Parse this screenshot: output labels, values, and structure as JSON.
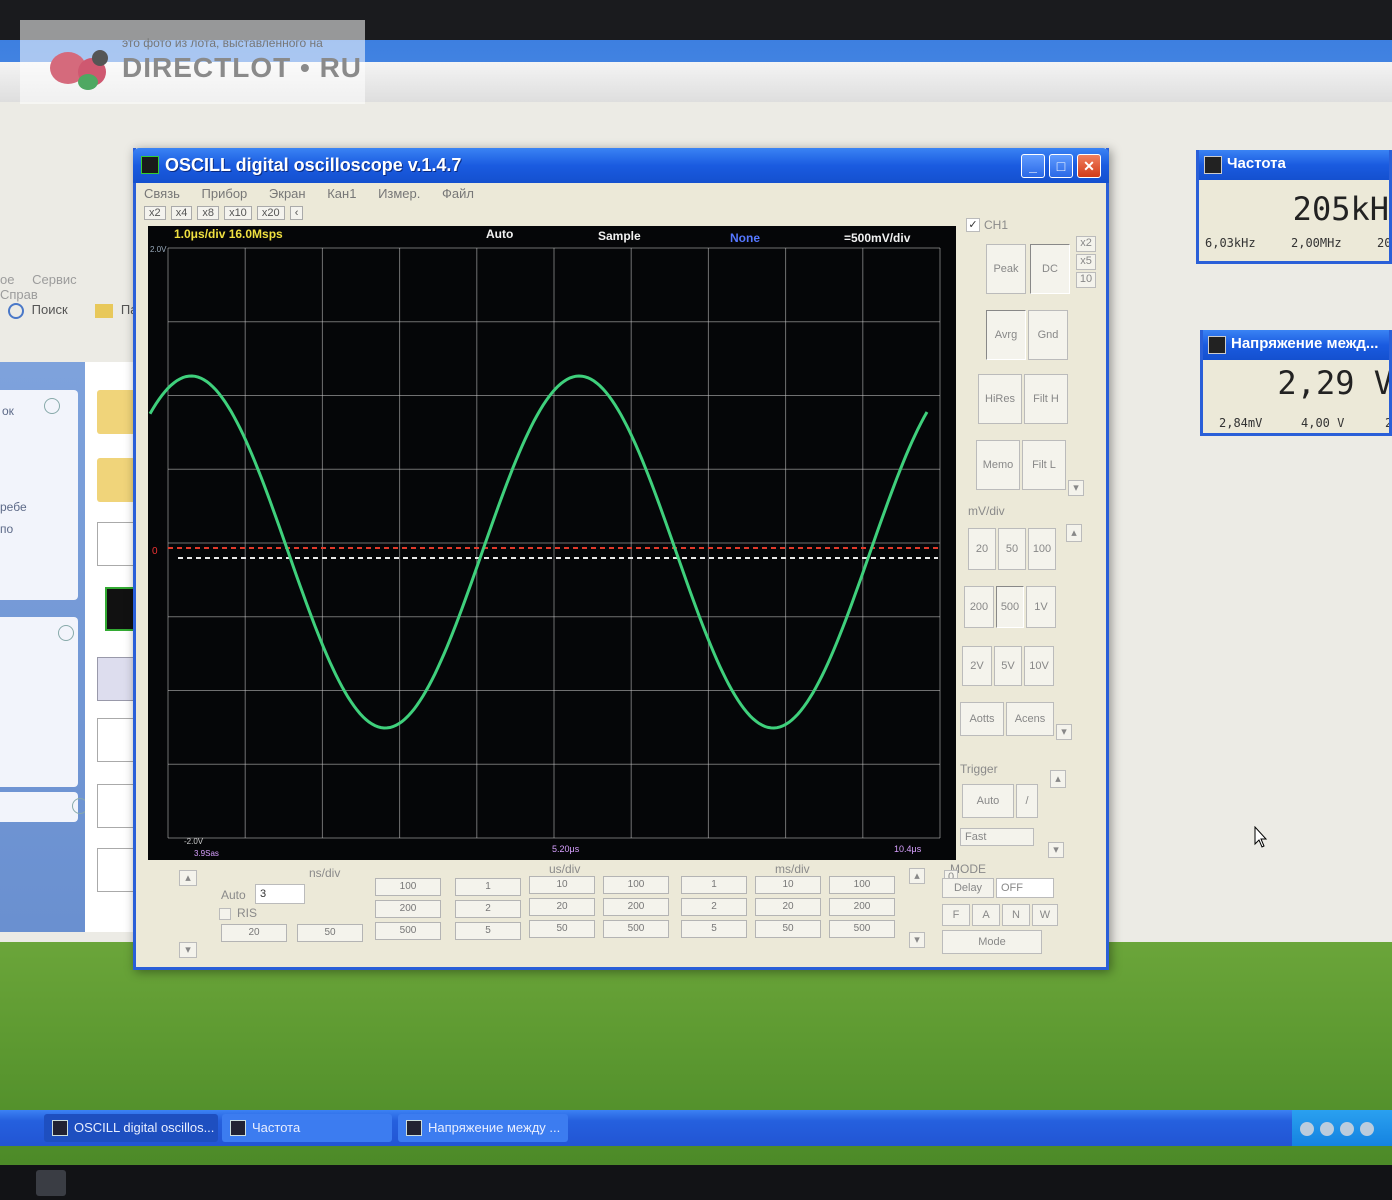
{
  "watermark": {
    "small_text": "это фото из лота, выставленного на",
    "big_text": "DIRECTLOT • RU"
  },
  "explorer": {
    "menu": [
      "ое",
      "Сервис",
      "Справ"
    ],
    "toolbar_search": "Поиск",
    "toolbar_folders": "Па",
    "panel1_label": "ок",
    "panel1_line1": "ребе",
    "panel1_line2": "по"
  },
  "oscill": {
    "title": "OSCILL digital oscilloscope  v.1.4.7",
    "menu": [
      "Связь",
      "Прибор",
      "Экран",
      "Кан1",
      "Измер.",
      "Файл"
    ],
    "zoom_buttons": [
      "x2",
      "x4",
      "x8",
      "x10",
      "x20",
      "‹"
    ],
    "screen": {
      "timebase_label": "1.0μs/div  16.0Msps",
      "trigger_mode": "Auto",
      "acq_mode": "Sample",
      "filter": "None",
      "volts_label": "=500mV/div",
      "bottom_center": "5.20μs",
      "bottom_right": "10.4μs",
      "bottom_left": "3.9Sas",
      "bottom_left_top": "-2.0V",
      "top_left": "2.0V",
      "left_marker": "0"
    },
    "right_panel": {
      "ch1_label": "CH1",
      "ch1_checked": true,
      "mult": [
        "x2",
        "x5",
        "10"
      ],
      "peak": "Peak",
      "dc": "DC",
      "avrg": "Avrg",
      "gnd": "Gnd",
      "hires": "HiRes",
      "filt_h": "Filt H",
      "memo": "Memo",
      "filt_l": "Filt L",
      "mvdiv_label": "mV/div",
      "volt_buttons": [
        "20",
        "50",
        "100",
        "200",
        "500",
        "1V",
        "2V",
        "5V",
        "10V"
      ],
      "aotts": "Aotts",
      "acens": "Acens",
      "trigger_label": "Trigger",
      "trigger_auto": "Auto",
      "trigger_slope": "/",
      "fast": "Fast",
      "mode_label": "MODE",
      "delay": "Delay",
      "delay_value": "OFF",
      "mode_letters": [
        "F",
        "A",
        "N",
        "W"
      ],
      "mode_button": "Mode",
      "zero": "0"
    },
    "bottom_panel": {
      "ns_div": "ns/div",
      "us_div": "us/div",
      "ms_div": "ms/div",
      "auto_label": "Auto",
      "auto_value": "3",
      "ris_label": "RIS",
      "ns_values": [
        "100",
        "200",
        "500",
        "20",
        "50"
      ],
      "us_values": [
        "1",
        "10",
        "100",
        "2",
        "20",
        "200",
        "5",
        "50",
        "500"
      ],
      "ms_values": [
        "1",
        "10",
        "100",
        "2",
        "20",
        "200",
        "5",
        "50",
        "500"
      ]
    }
  },
  "freq_meter": {
    "title": "Частота",
    "value": "205kH",
    "subs": [
      "6,03kHz",
      "2,00MHz",
      "20"
    ]
  },
  "volt_meter": {
    "title": "Напряжение межд...",
    "value": "2,29 V",
    "subs": [
      "2,84mV",
      "4,00 V",
      "2"
    ]
  },
  "taskbar": {
    "items": [
      "OSCILL digital oscillos...",
      "Частота",
      "Напряжение между ..."
    ]
  },
  "colors": {
    "trace": "#3fd07c",
    "grid": "#c8c8c8",
    "trigger_line": "#e23a2a",
    "zero_line": "#e8e8e8",
    "header_yellow": "#f0e040",
    "header_blue": "#5577ff",
    "xp_title_blue": "#1a5be0"
  }
}
